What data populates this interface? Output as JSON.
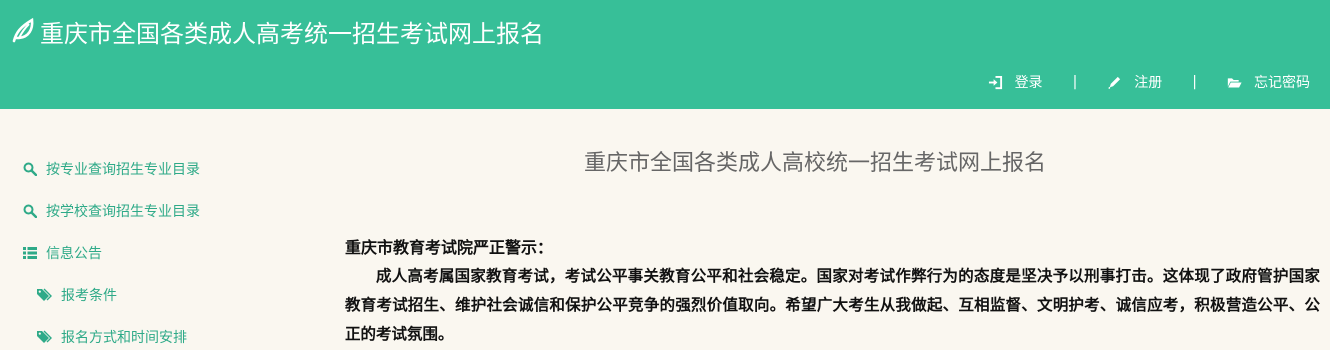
{
  "header": {
    "title": "重庆市全国各类成人高考统一招生考试网上报名",
    "bg_color": "#37bf98",
    "nav": {
      "login": "登录",
      "register": "注册",
      "forgot": "忘记密码",
      "separator": "|"
    }
  },
  "sidebar": {
    "items": [
      {
        "label": "按专业查询招生专业目录",
        "icon": "search-icon"
      },
      {
        "label": "按学校查询招生专业目录",
        "icon": "search-icon"
      },
      {
        "label": "信息公告",
        "icon": "list-icon"
      },
      {
        "label": "报考条件",
        "icon": "tags-icon"
      },
      {
        "label": "报名方式和时间安排",
        "icon": "tags-icon"
      }
    ]
  },
  "main": {
    "title": "重庆市全国各类成人高校统一招生考试网上报名",
    "warning_heading": "重庆市教育考试院严正警示：",
    "warning_body": "成人高考属国家教育考试，考试公平事关教育公平和社会稳定。国家对考试作弊行为的态度是坚决予以刑事打击。这体现了政府管护国家教育考试招生、维护社会诚信和保护公平竞争的强烈价值取向。希望广大考生从我做起、互相监督、文明护考、诚信应考，积极营造公平、公正的考试氛围。"
  }
}
